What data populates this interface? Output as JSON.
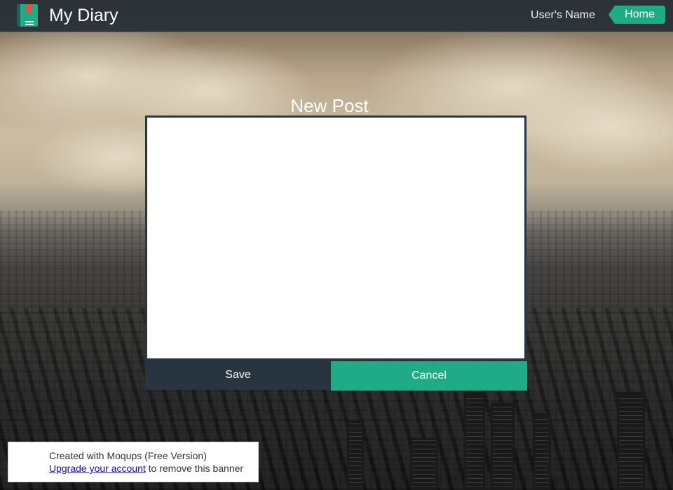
{
  "header": {
    "app_title": "My Diary",
    "user_name": "User's Name",
    "home_label": "Home"
  },
  "post": {
    "title": "New Post",
    "content": "",
    "save_label": "Save",
    "cancel_label": "Cancel"
  },
  "banner": {
    "line1": "Created with Moqups (Free Version)",
    "upgrade_link": "Upgrade your account",
    "line2_suffix": " to remove this banner"
  },
  "colors": {
    "accent": "#1eab85",
    "dark": "#283540",
    "topbar": "#282f36",
    "logo_tab": "#e1553d"
  },
  "icons": {
    "logo": "diary-book-icon"
  }
}
